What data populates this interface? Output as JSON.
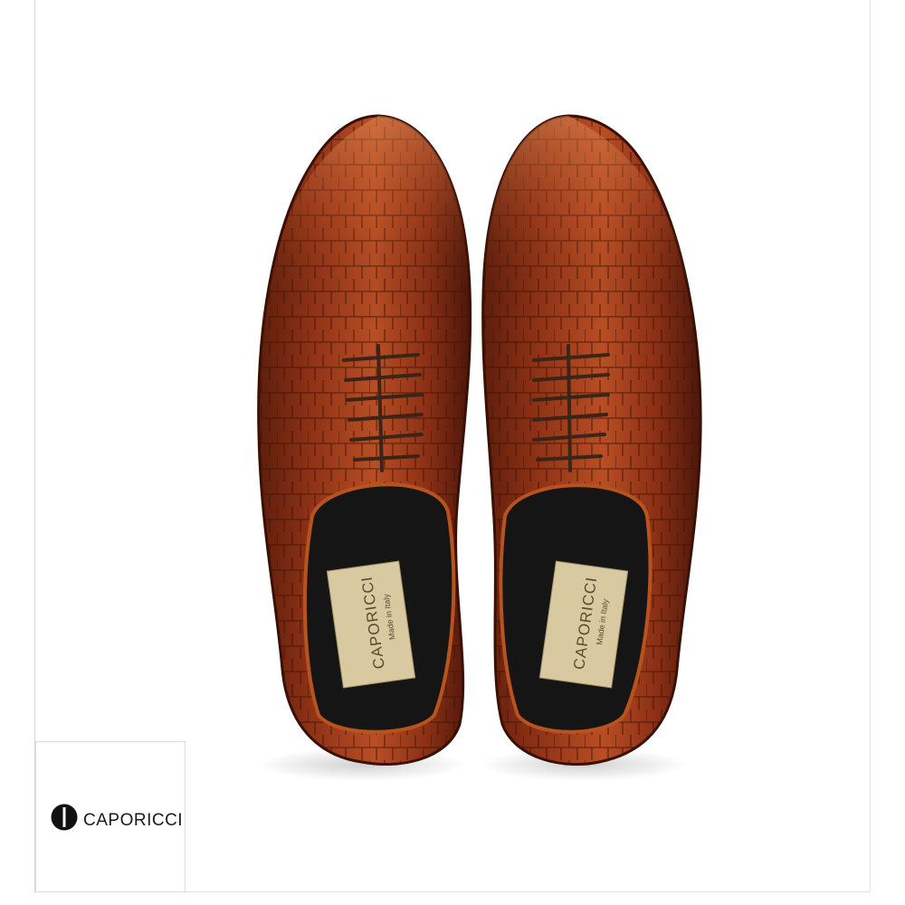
{
  "logo": {
    "text": "CAPORICCI"
  },
  "insole_labels": [
    {
      "brand": "CAPORICCI",
      "tagline": "Made in Italy"
    },
    {
      "brand": "CAPORICCI",
      "tagline": "Made in Italy"
    }
  ],
  "colors": {
    "leather": "#9c3a1c",
    "leather_dark": "#5e1e0c",
    "lining": "#151515",
    "insole_label": "#d8c9a0",
    "background": "#ffffff"
  }
}
